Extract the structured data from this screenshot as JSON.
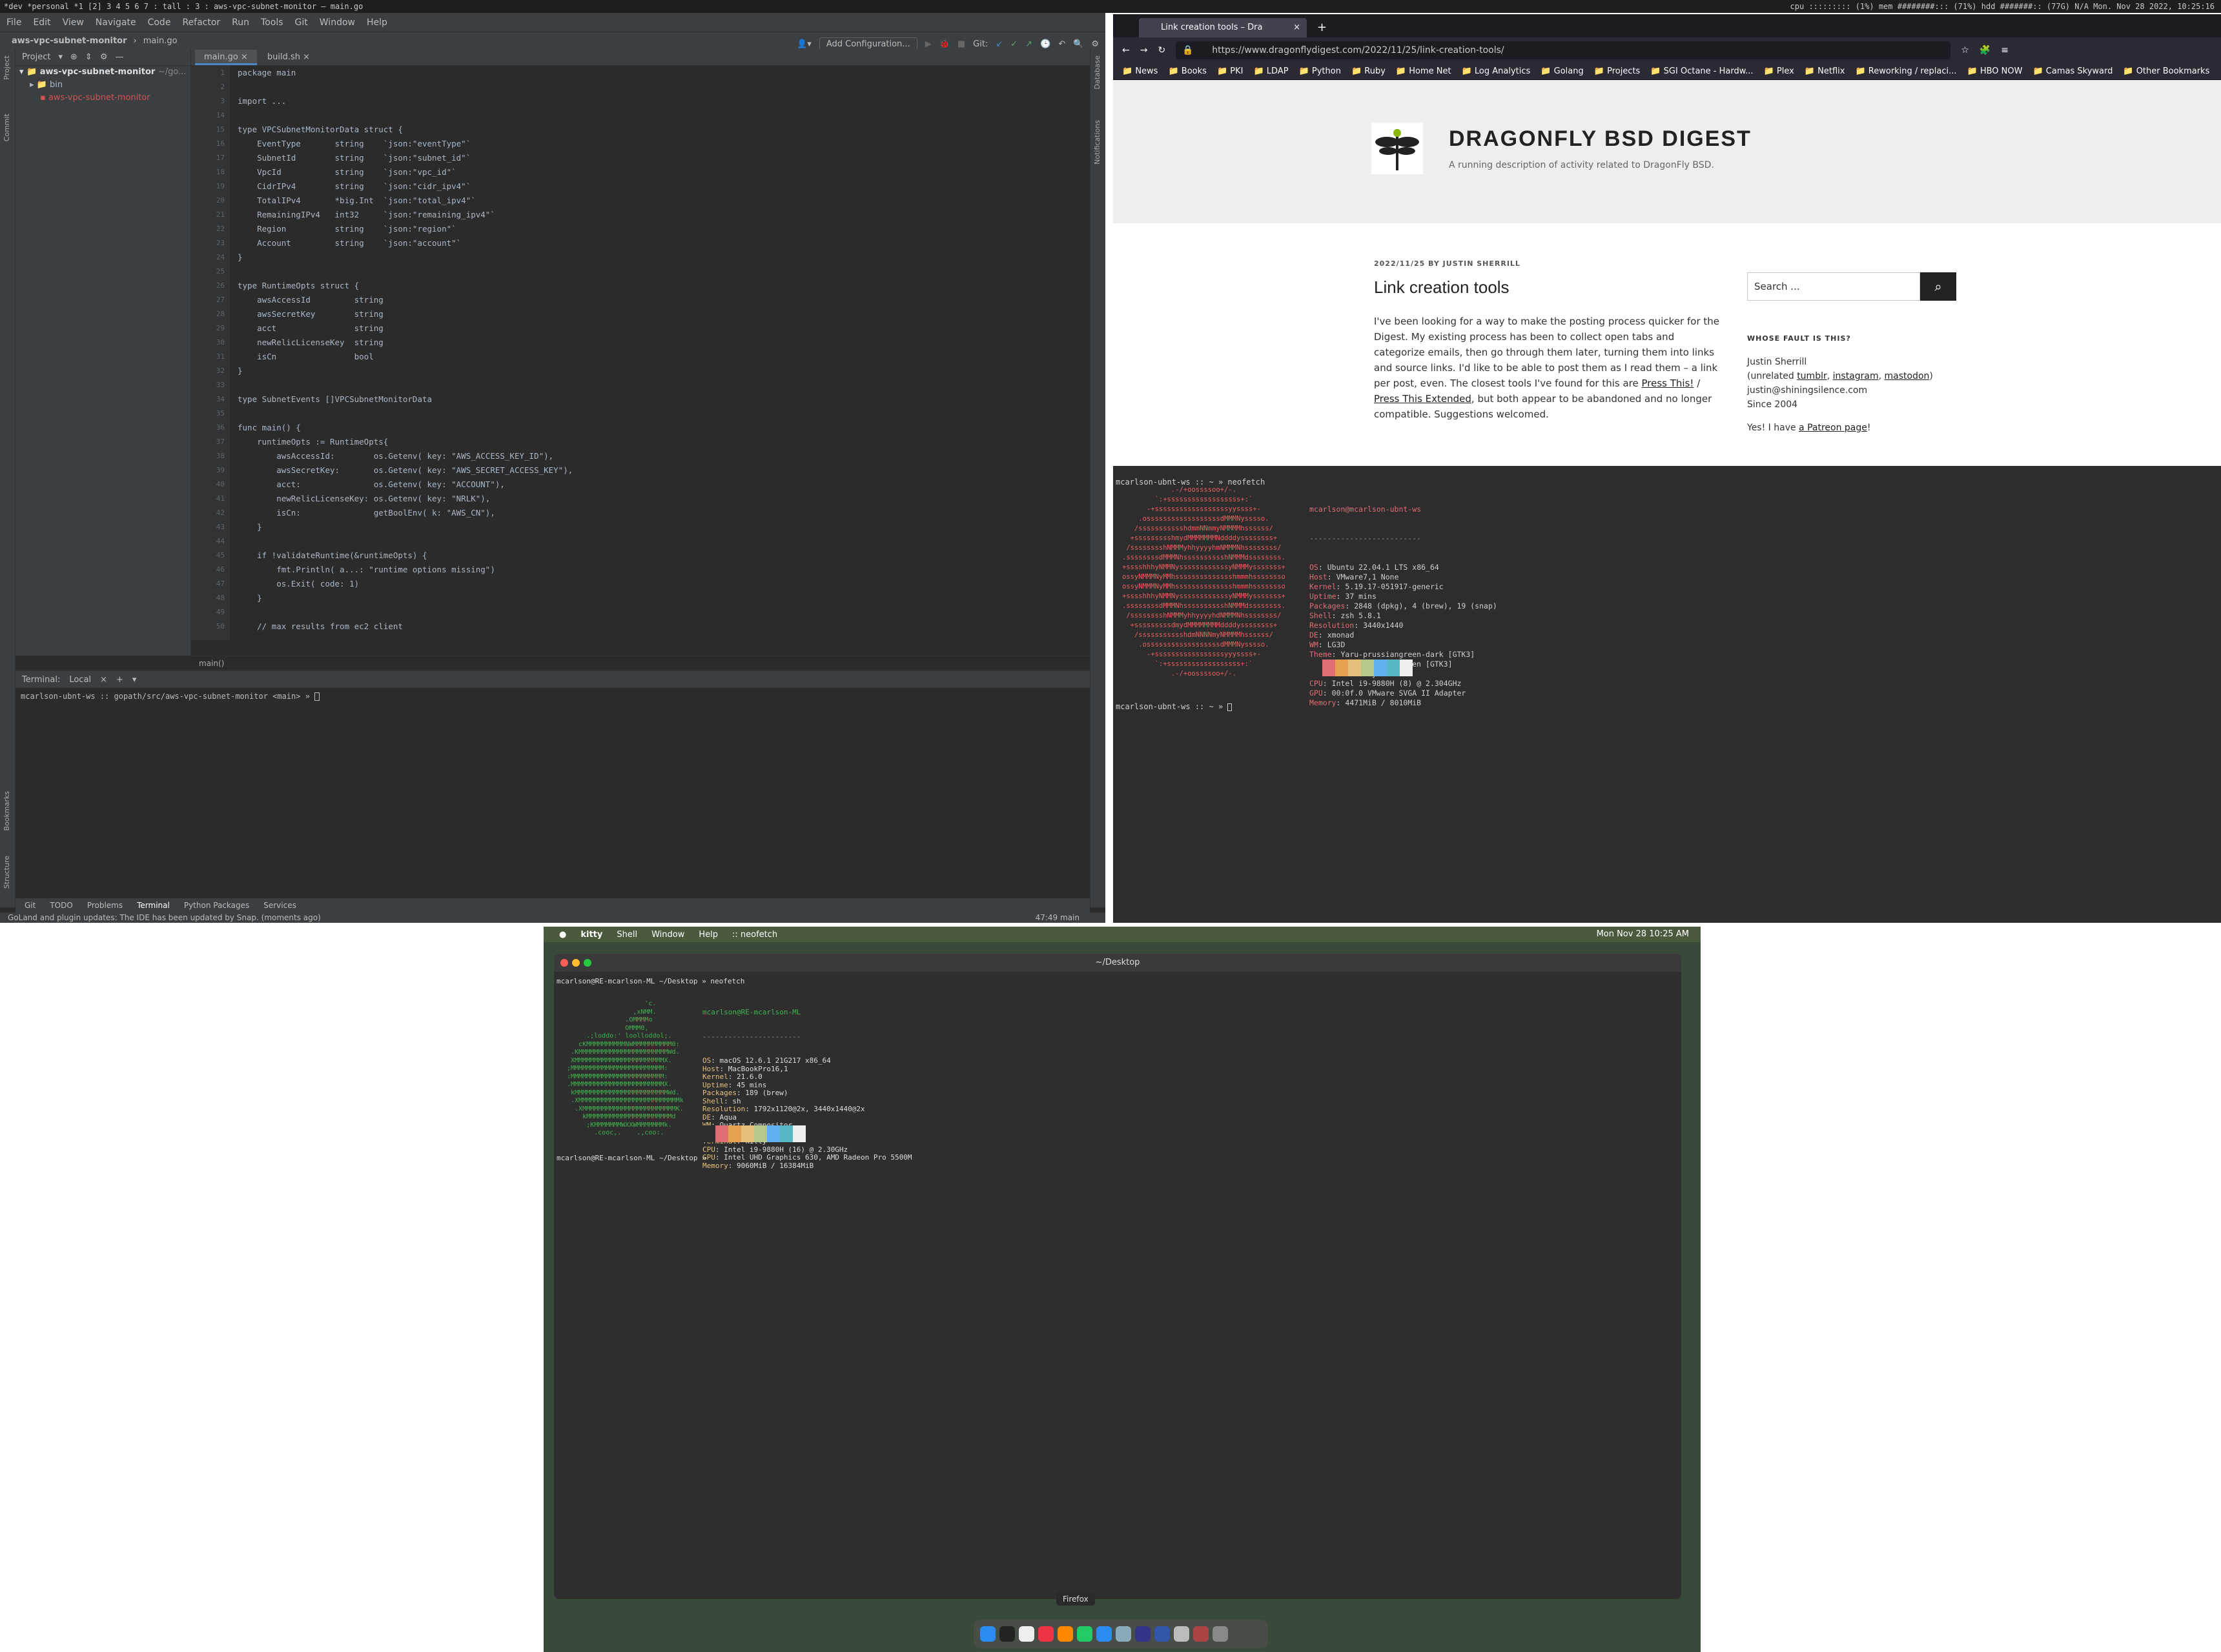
{
  "topbar": {
    "left": "*dev *personal *1 [2] 3 4 5 6 7 : tall : 3 : aws-vpc-subnet-monitor – main.go",
    "right": "cpu ::::::::: (1%)  mem ########::: (71%)  hdd #######:: (77G)  N/A  Mon. Nov 28 2022, 10:25:16"
  },
  "ide": {
    "menu": [
      "File",
      "Edit",
      "View",
      "Navigate",
      "Code",
      "Refactor",
      "Run",
      "Tools",
      "Git",
      "Window",
      "Help"
    ],
    "nav": {
      "project": "aws-vpc-subnet-monitor",
      "file": "main.go"
    },
    "add_config": "Add Configuration...",
    "git_label": "Git:",
    "project_label": "Project",
    "tree": [
      {
        "label": "aws-vpc-subnet-monitor",
        "extra": "~/go..."
      },
      {
        "label": "bin"
      },
      {
        "label": "aws-vpc-subnet-monitor"
      }
    ],
    "tabs": [
      "main.go",
      "build.sh"
    ],
    "code": [
      {
        "n": "1",
        "t": "package main"
      },
      {
        "n": "2",
        "t": ""
      },
      {
        "n": "3",
        "t": "import ..."
      },
      {
        "n": "14",
        "t": ""
      },
      {
        "n": "15",
        "t": "type VPCSubnetMonitorData struct {"
      },
      {
        "n": "16",
        "t": "    EventType       string    `json:\"eventType\"`"
      },
      {
        "n": "17",
        "t": "    SubnetId        string    `json:\"subnet_id\"`"
      },
      {
        "n": "18",
        "t": "    VpcId           string    `json:\"vpc_id\"`"
      },
      {
        "n": "19",
        "t": "    CidrIPv4        string    `json:\"cidr_ipv4\"`"
      },
      {
        "n": "20",
        "t": "    TotalIPv4       *big.Int  `json:\"total_ipv4\"`"
      },
      {
        "n": "21",
        "t": "    RemainingIPv4   int32     `json:\"remaining_ipv4\"`"
      },
      {
        "n": "22",
        "t": "    Region          string    `json:\"region\"`"
      },
      {
        "n": "23",
        "t": "    Account         string    `json:\"account\"`"
      },
      {
        "n": "24",
        "t": "}"
      },
      {
        "n": "25",
        "t": ""
      },
      {
        "n": "26",
        "t": "type RuntimeOpts struct {"
      },
      {
        "n": "27",
        "t": "    awsAccessId         string"
      },
      {
        "n": "28",
        "t": "    awsSecretKey        string"
      },
      {
        "n": "29",
        "t": "    acct                string"
      },
      {
        "n": "30",
        "t": "    newRelicLicenseKey  string"
      },
      {
        "n": "31",
        "t": "    isCn                bool"
      },
      {
        "n": "32",
        "t": "}"
      },
      {
        "n": "33",
        "t": ""
      },
      {
        "n": "34",
        "t": "type SubnetEvents []VPCSubnetMonitorData"
      },
      {
        "n": "35",
        "t": ""
      },
      {
        "n": "36",
        "t": "func main() {"
      },
      {
        "n": "37",
        "t": "    runtimeOpts := RuntimeOpts{"
      },
      {
        "n": "38",
        "t": "        awsAccessId:        os.Getenv( key: \"AWS_ACCESS_KEY_ID\"),"
      },
      {
        "n": "39",
        "t": "        awsSecretKey:       os.Getenv( key: \"AWS_SECRET_ACCESS_KEY\"),"
      },
      {
        "n": "40",
        "t": "        acct:               os.Getenv( key: \"ACCOUNT\"),"
      },
      {
        "n": "41",
        "t": "        newRelicLicenseKey: os.Getenv( key: \"NRLK\"),"
      },
      {
        "n": "42",
        "t": "        isCn:               getBoolEnv( k: \"AWS_CN\"),"
      },
      {
        "n": "43",
        "t": "    }"
      },
      {
        "n": "44",
        "t": ""
      },
      {
        "n": "45",
        "t": "    if !validateRuntime(&runtimeOpts) {"
      },
      {
        "n": "46",
        "t": "        fmt.Println( a...: \"runtime options missing\")"
      },
      {
        "n": "47",
        "t": "        os.Exit( code: 1)"
      },
      {
        "n": "48",
        "t": "    }"
      },
      {
        "n": "49",
        "t": ""
      },
      {
        "n": "50",
        "t": "    // max results from ec2 client"
      }
    ],
    "breadcrumb": "main()",
    "terminal": {
      "label": "Terminal:",
      "tab": "Local",
      "prompt": "mcarlson-ubnt-ws :: gopath/src/aws-vpc-subnet-monitor <main> »"
    },
    "bottom_tabs": [
      "Git",
      "TODO",
      "Problems",
      "Terminal",
      "Python Packages",
      "Services"
    ],
    "status": "GoLand and plugin updates: The IDE has been updated by Snap. (moments ago)",
    "status_right": "47:49   main"
  },
  "firefox": {
    "tab_title": "Link creation tools – Dra",
    "url": "https://www.dragonflydigest.com/2022/11/25/link-creation-tools/",
    "bookmarks": [
      "News",
      "Books",
      "PKI",
      "LDAP",
      "Python",
      "Ruby",
      "Home Net",
      "Log Analytics",
      "Golang",
      "Projects",
      "SGI Octane - Hardw...",
      "Plex",
      "Netflix",
      "Reworking / replaci...",
      "HBO NOW",
      "Camas Skyward",
      "Other Bookmarks"
    ],
    "site_title": "DRAGONFLY BSD DIGEST",
    "site_desc": "A running description of activity related to DragonFly BSD.",
    "meta": "2022/11/25 BY JUSTIN SHERRILL",
    "post_title": "Link creation tools",
    "post_body_1": "I've been looking for a way to make the posting process quicker for the Digest.  My existing process has been to collect open tabs and categorize emails, then go through them later, turning them into links and source links.  I'd like to be able to post them as I read them – a link per post, even.  The closest tools I've found for this are ",
    "link1": "Press This!",
    "sep": " / ",
    "link2": "Press This Extended",
    "post_body_2": ", but both appear to be abandoned and no longer compatible.  Suggestions welcomed.",
    "search_placeholder": "Search ...",
    "side_heading": "WHOSE FAULT IS THIS?",
    "side_name": "Justin Sherrill",
    "side_unrelated": "(unrelated ",
    "side_links": [
      "tumblr",
      "instagram",
      "mastodon"
    ],
    "side_email": "justin@shiningsilence.com",
    "side_since": "Since 2004",
    "side_patreon_pre": "Yes! I have ",
    "side_patreon_link": "a Patreon page",
    "side_patreon_post": "!"
  },
  "rterm": {
    "cmd": "mcarlson-ubnt-ws :: ~ » neofetch",
    "ascii": "            .-/+oossssoo+/-.\n        `:+ssssssssssssssssss+:`\n      -+ssssssssssssssssssyyssss+-\n    .ossssssssssssssssssdMMMNysssso.\n   /ssssssssssshdmmNNmmyNMMMMhssssss/\n  +ssssssssshmydMMMMMMMNddddyssssssss+\n /sssssssshNMMMyhhyyyyhmNMMMNhssssssss/\n.ssssssssdMMMNhsssssssssshNMMMdssssssss.\n+sssshhhyNMMNyssssssssssssyNMMMysssssss+\nossyNMMMNyMMhsssssssssssssshmmmhssssssso\nossyNMMMNyMMhsssssssssssssshmmmhssssssso\n+sssshhhyNMMNyssssssssssssyNMMMysssssss+\n.ssssssssdMMMNhsssssssssshNMMMdssssssss.\n /sssssssshNMMMyhhyyyyhdNMMMNhssssssss/\n  +sssssssssdmydMMMMMMMMddddyssssssss+\n   /ssssssssssshdmNNNNmyNMMMMhssssss/\n    .ossssssssssssssssssdMMMNysssso.\n      -+sssssssssssssssssyyyssss+-\n        `:+ssssssssssssssssss+:`\n            .-/+oossssoo+/-.",
    "user": "mcarlson@mcarlson-ubnt-ws",
    "info": [
      {
        "k": "OS",
        "v": "Ubuntu 22.04.1 LTS x86_64"
      },
      {
        "k": "Host",
        "v": "VMware7,1 None"
      },
      {
        "k": "Kernel",
        "v": "5.19.17-051917-generic"
      },
      {
        "k": "Uptime",
        "v": "37 mins"
      },
      {
        "k": "Packages",
        "v": "2848 (dpkg), 4 (brew), 19 (snap)"
      },
      {
        "k": "Shell",
        "v": "zsh 5.8.1"
      },
      {
        "k": "Resolution",
        "v": "3440x1440"
      },
      {
        "k": "DE",
        "v": "xmonad"
      },
      {
        "k": "WM",
        "v": "LG3D"
      },
      {
        "k": "Theme",
        "v": "Yaru-prussiangreen-dark [GTK3]"
      },
      {
        "k": "Icons",
        "v": "Yaru-prussiangreen [GTK3]"
      },
      {
        "k": "Terminal",
        "v": "kitty"
      },
      {
        "k": "CPU",
        "v": "Intel i9-9880H (8) @ 2.304GHz"
      },
      {
        "k": "GPU",
        "v": "00:0f.0 VMware SVGA II Adapter"
      },
      {
        "k": "Memory",
        "v": "4471MiB / 8010MiB"
      }
    ],
    "prompt2": "mcarlson-ubnt-ws :: ~ »"
  },
  "mac": {
    "menu": [
      "kitty",
      "Shell",
      "Window",
      "Help",
      ":: neofetch"
    ],
    "clock": "Mon Nov 28  10:25 AM",
    "win_title": "~/Desktop",
    "cmd": "mcarlson@RE-mcarlson-ML ~/Desktop » neofetch",
    "user": "mcarlson@RE-mcarlson-ML",
    "ascii": "                    'c.\n                 ,xNMM.\n               .OMMMMo\n               OMMM0,\n     .;loddo:' loolloddol;.\n   cKMMMMMMMMMMNWMMMMMMMMMM0:\n .KMMMMMMMMMMMMMMMMMMMMMMMWd.\n XMMMMMMMMMMMMMMMMMMMMMMMX.\n;MMMMMMMMMMMMMMMMMMMMMMMM:\n:MMMMMMMMMMMMMMMMMMMMMMMM:\n.MMMMMMMMMMMMMMMMMMMMMMMMX.\n kMMMMMMMMMMMMMMMMMMMMMMMMWd.\n .XMMMMMMMMMMMMMMMMMMMMMMMMMMk\n  .XMMMMMMMMMMMMMMMMMMMMMMMMK.\n    kMMMMMMMMMMMMMMMMMMMMMMd\n     ;KMMMMMMMWXXWMMMMMMMk.\n       .cooc,.    .,coo:.",
    "info": [
      {
        "k": "OS",
        "v": "macOS 12.6.1 21G217 x86_64"
      },
      {
        "k": "Host",
        "v": "MacBookPro16,1"
      },
      {
        "k": "Kernel",
        "v": "21.6.0"
      },
      {
        "k": "Uptime",
        "v": "45 mins"
      },
      {
        "k": "Packages",
        "v": "189 (brew)"
      },
      {
        "k": "Shell",
        "v": "sh"
      },
      {
        "k": "Resolution",
        "v": "1792x1120@2x, 3440x1440@2x"
      },
      {
        "k": "DE",
        "v": "Aqua"
      },
      {
        "k": "WM",
        "v": "Quartz Compositor"
      },
      {
        "k": "WM Theme",
        "v": "Blue (Dark)"
      },
      {
        "k": "Terminal",
        "v": "kitty"
      },
      {
        "k": "CPU",
        "v": "Intel i9-9880H (16) @ 2.30GHz"
      },
      {
        "k": "GPU",
        "v": "Intel UHD Graphics 630, AMD Radeon Pro 5500M"
      },
      {
        "k": "Memory",
        "v": "9060MiB / 16384MiB"
      }
    ],
    "prompt2": "mcarlson@RE-mcarlson-ML ~/Desktop »",
    "tooltip": "Firefox"
  }
}
